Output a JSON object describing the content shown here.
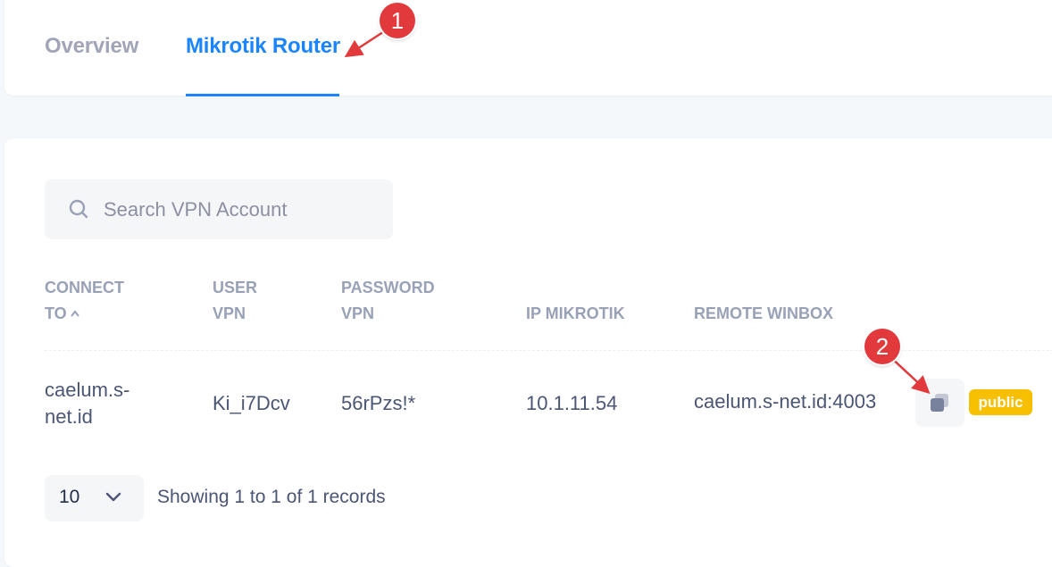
{
  "tabs": [
    {
      "label": "Overview",
      "active": false
    },
    {
      "label": "Mikrotik Router",
      "active": true
    }
  ],
  "search": {
    "placeholder": "Search VPN Account",
    "value": ""
  },
  "table": {
    "headers": {
      "connect_to_line1": "CONNECT",
      "connect_to_line2": "TO",
      "user_vpn_line1": "USER",
      "user_vpn_line2": "VPN",
      "password_vpn_line1": "PASSWORD",
      "password_vpn_line2": "VPN",
      "ip_mikrotik": "IP MIKROTIK",
      "remote_winbox": "REMOTE WINBOX"
    },
    "sort": {
      "column": "connect_to",
      "direction": "ascending"
    },
    "rows": [
      {
        "connect_to_line1": "caelum.s-",
        "connect_to_line2": "net.id",
        "user_vpn": "Ki_i7Dcv",
        "password_vpn": "56rPzs!*",
        "ip_mikrotik": "10.1.11.54",
        "remote_winbox": "caelum.s-net.id:4003",
        "badge": "public"
      }
    ]
  },
  "pagination": {
    "page_size": "10",
    "records_info": "Showing 1 to 1 of 1 records"
  },
  "annotations": [
    {
      "number": "1",
      "target": "Mikrotik Router tab"
    },
    {
      "number": "2",
      "target": "copy button"
    }
  ],
  "colors": {
    "accent": "#1b84ff",
    "muted_text": "#99a1b7",
    "body_text": "#4b5675",
    "badge_warning": "#f6c000",
    "callout": "#e23a3c"
  },
  "icons": [
    "search-icon",
    "sort-asc-icon",
    "copy-icon",
    "chevron-down-icon"
  ]
}
